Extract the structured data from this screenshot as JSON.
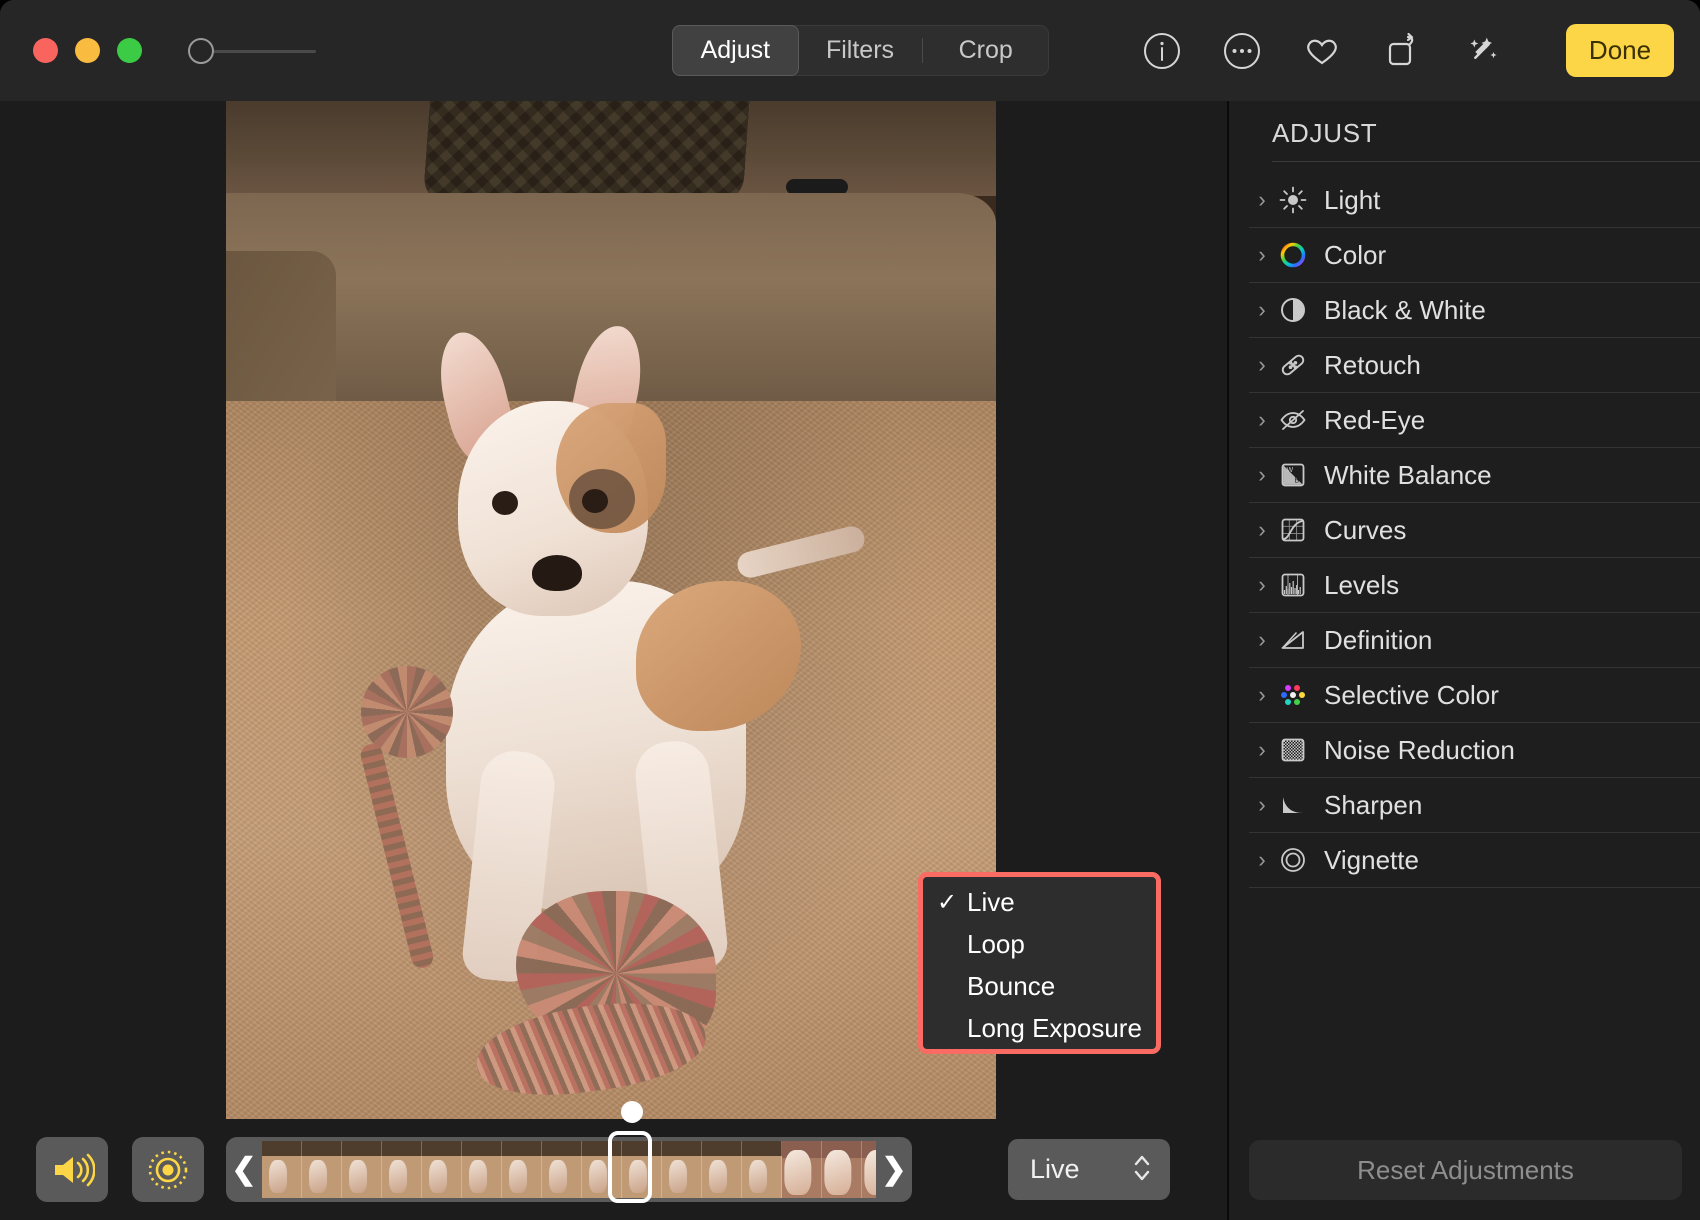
{
  "window": {
    "traffic_lights": [
      {
        "name": "close",
        "color": "#f9655e"
      },
      {
        "name": "minimize",
        "color": "#f9bc40"
      },
      {
        "name": "zoom",
        "color": "#3ccb45"
      }
    ],
    "zoom_slider_value": 0
  },
  "toolbar": {
    "tabs": [
      {
        "label": "Adjust",
        "active": true
      },
      {
        "label": "Filters",
        "active": false
      },
      {
        "label": "Crop",
        "active": false
      }
    ],
    "icons": [
      {
        "name": "info-icon",
        "glyph": "i"
      },
      {
        "name": "more-options-icon",
        "glyph": "..."
      },
      {
        "name": "favorite-heart-icon",
        "glyph": "heart"
      },
      {
        "name": "rotate-icon",
        "glyph": "rotate"
      },
      {
        "name": "auto-enhance-icon",
        "glyph": "magic-wand"
      }
    ],
    "done_label": "Done",
    "done_color": "#fcd646"
  },
  "sidebar": {
    "title": "ADJUST",
    "items": [
      {
        "label": "Light",
        "icon": "brightness-sun-icon"
      },
      {
        "label": "Color",
        "icon": "color-wheel-icon"
      },
      {
        "label": "Black & White",
        "icon": "half-circle-contrast-icon"
      },
      {
        "label": "Retouch",
        "icon": "bandage-icon"
      },
      {
        "label": "Red-Eye",
        "icon": "eye-slash-icon"
      },
      {
        "label": "White Balance",
        "icon": "white-balance-icon"
      },
      {
        "label": "Curves",
        "icon": "curves-icon"
      },
      {
        "label": "Levels",
        "icon": "levels-histogram-icon"
      },
      {
        "label": "Definition",
        "icon": "definition-triangle-icon"
      },
      {
        "label": "Selective Color",
        "icon": "selective-color-dots-icon"
      },
      {
        "label": "Noise Reduction",
        "icon": "noise-reduction-icon"
      },
      {
        "label": "Sharpen",
        "icon": "sharpen-triangle-icon"
      },
      {
        "label": "Vignette",
        "icon": "vignette-rings-icon"
      }
    ],
    "reset_label": "Reset Adjustments"
  },
  "bottom_bar": {
    "speaker_button": {
      "name": "speaker-icon",
      "color": "#fcd646"
    },
    "live_photo_button": {
      "name": "live-photo-icon",
      "color": "#fcd646"
    },
    "filmstrip": {
      "prev_arrow": "❮",
      "next_arrow": "❯",
      "frame_count": 16,
      "selected_frame_index": 9
    },
    "live_select": {
      "value": "Live",
      "options": [
        "Live",
        "Loop",
        "Bounce",
        "Long Exposure"
      ]
    }
  },
  "popup_menu": {
    "highlight_color": "#fa6b63",
    "items": [
      {
        "label": "Live",
        "checked": true
      },
      {
        "label": "Loop",
        "checked": false
      },
      {
        "label": "Bounce",
        "checked": false
      },
      {
        "label": "Long Exposure",
        "checked": false
      }
    ]
  }
}
